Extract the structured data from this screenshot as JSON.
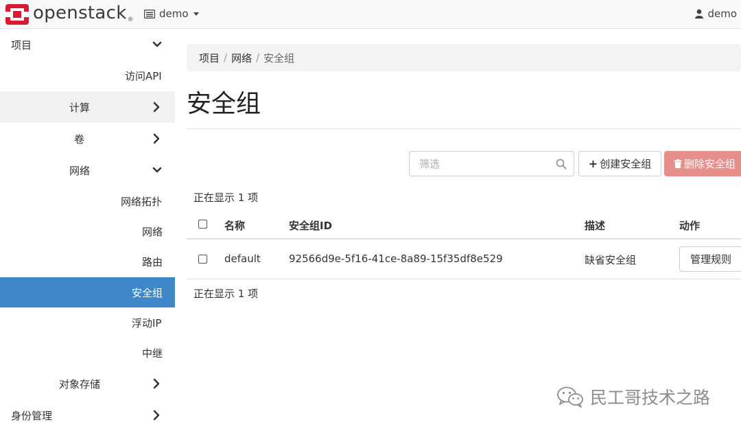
{
  "topbar": {
    "logo_text": "openstack",
    "logo_reg": "®",
    "project": "demo",
    "user": "demo"
  },
  "sidebar": {
    "project": "项目",
    "access_api": "访问API",
    "compute": "计算",
    "volumes": "卷",
    "network": "网络",
    "network_topology": "网络拓扑",
    "networks": "网络",
    "routers": "路由",
    "security_groups": "安全组",
    "floating_ips": "浮动IP",
    "trunks": "中继",
    "object_store": "对象存储",
    "identity": "身份管理"
  },
  "breadcrumb": {
    "items": [
      "项目",
      "网络",
      "安全组"
    ]
  },
  "page": {
    "title": "安全组"
  },
  "toolbar": {
    "filter_placeholder": "筛选",
    "create_label": "创建安全组",
    "delete_label": "删除安全组"
  },
  "table": {
    "count_top": "正在显示 1 项",
    "count_bottom": "正在显示 1 项",
    "columns": [
      "名称",
      "安全组ID",
      "描述",
      "动作"
    ],
    "rows": [
      {
        "name": "default",
        "id": "92566d9e-5f16-41ce-8a89-15f35df8e529",
        "description": "缺省安全组",
        "action": "管理规则"
      }
    ]
  },
  "watermark": "民工哥技术之路",
  "colors": {
    "active_nav": "#3e87c8",
    "delete_button": "#e68f8b",
    "logo_red": "#da1a32"
  }
}
